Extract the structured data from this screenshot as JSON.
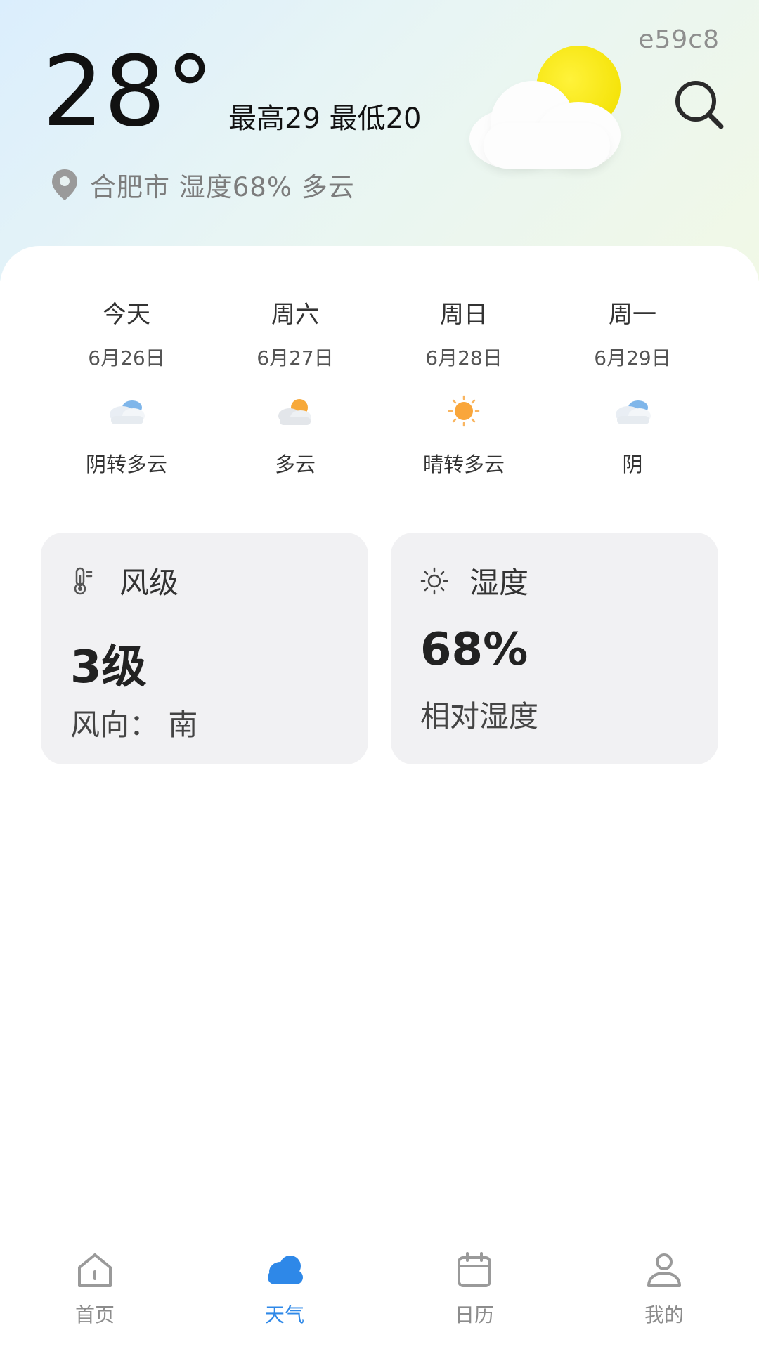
{
  "header": {
    "code": "e59c8",
    "temperature": "28°",
    "high_low": "最高29 最低20",
    "location_line": "合肥市 湿度68% 多云",
    "weather_icon": "partly-cloudy-sun-icon",
    "search_icon": "search-icon"
  },
  "forecast": [
    {
      "day": "今天",
      "date": "6月26日",
      "desc": "阴转多云",
      "icon": "cloudy-icon"
    },
    {
      "day": "周六",
      "date": "6月27日",
      "desc": "多云",
      "icon": "partly-cloudy-icon"
    },
    {
      "day": "周日",
      "date": "6月28日",
      "desc": "晴转多云",
      "icon": "sunny-icon"
    },
    {
      "day": "周一",
      "date": "6月29日",
      "desc": "阴",
      "icon": "cloudy-icon"
    }
  ],
  "cards": {
    "wind": {
      "title": "风级",
      "value": "3级",
      "sub": "风向：  南",
      "icon": "thermometer-icon"
    },
    "humidity": {
      "title": "湿度",
      "value": "68%",
      "sub": "相对湿度",
      "icon": "sun-outline-icon"
    }
  },
  "nav": [
    {
      "label": "首页",
      "icon": "home-icon",
      "active": false
    },
    {
      "label": "天气",
      "icon": "cloud-icon",
      "active": true
    },
    {
      "label": "日历",
      "icon": "calendar-icon",
      "active": false
    },
    {
      "label": "我的",
      "icon": "user-icon",
      "active": false
    }
  ],
  "colors": {
    "accent": "#2e88e8",
    "card_bg": "#f1f1f3",
    "sun": "#f5e40c"
  }
}
